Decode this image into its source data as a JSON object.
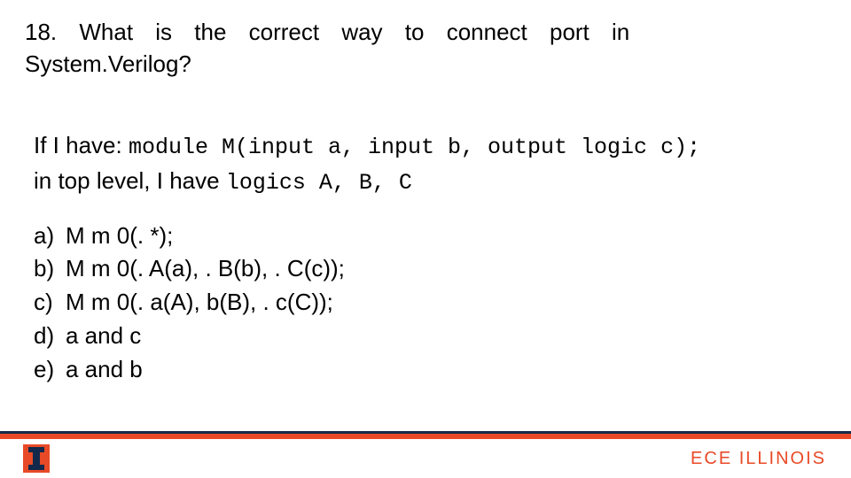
{
  "question": {
    "line1": "18.  What  is  the  correct  way  to  connect  port  in",
    "line2": "System.Verilog?"
  },
  "context": {
    "lead": "If I have:",
    "code_module": " module M(input a, input b, output logic c);",
    "line2_pre": "in top level, I have ",
    "line2_code": "logics A, B, C"
  },
  "options": {
    "a": {
      "label": "a)",
      "text": "M m 0(. *);"
    },
    "b": {
      "label": "b)",
      "text": "M m 0(. A(a), . B(b), . C(c));"
    },
    "c": {
      "label": "c)",
      "text": "M m 0(. a(A), b(B), . c(C));"
    },
    "d": {
      "label": "d)",
      "text": "a and c"
    },
    "e": {
      "label": "e)",
      "text": "a and b"
    }
  },
  "footer": {
    "ece_bold": "ECE ",
    "ece_light": "ILLINOIS"
  },
  "colors": {
    "illini_orange": "#e84a27",
    "illini_blue": "#13294b"
  }
}
